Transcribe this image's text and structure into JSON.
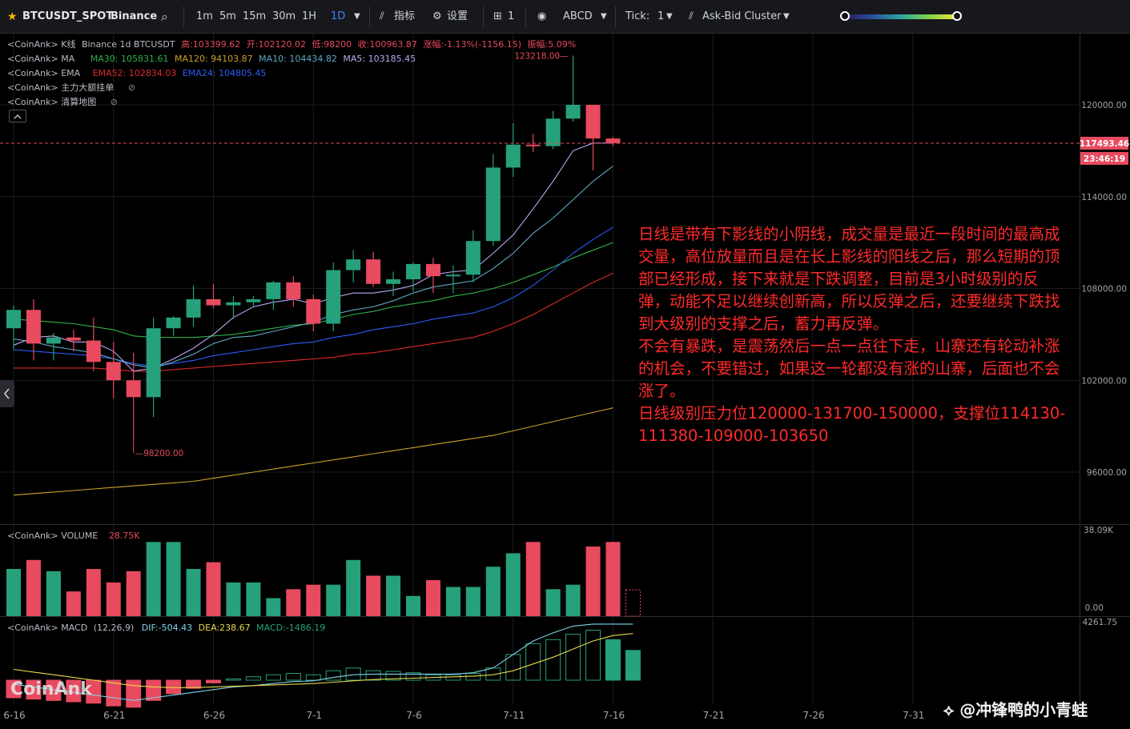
{
  "toolbar": {
    "symbol": "BTCUSDT_SPOT",
    "exchange": "Binance",
    "intervals": [
      "1m",
      "5m",
      "15m",
      "30m",
      "1H",
      "1D"
    ],
    "active_interval": "1D",
    "indicators_label": "指标",
    "settings_label": "设置",
    "layout_count": "1",
    "drawing_label": "ABCD",
    "tick_label": "Tick:",
    "tick_value": "1",
    "cluster_label": "Ask-Bid Cluster"
  },
  "legend": {
    "kline": {
      "prefix": "<CoinAnk> K线",
      "text": "Binance 1d BTCUSDT",
      "high": "高:103399.62",
      "open": "开:102120.02",
      "low": "低:98200",
      "close": "收:100963.87",
      "change": "涨幅:-1.13%(-1156.15)",
      "amplitude": "振幅:5.09%"
    },
    "ma": {
      "prefix": "<CoinAnk> MA",
      "ma30": "MA30: 105831.61",
      "ma120": "MA120: 94103.87",
      "ma10": "MA10: 104434.82",
      "ma5": "MA5: 103185.45"
    },
    "ema": {
      "prefix": "<CoinAnk> EMA",
      "ema52": "EMA52: 102834.03",
      "ema24": "EMA24: 104805.45"
    },
    "big_orders": "<CoinAnk> 主力大额挂单",
    "liquidation": "<CoinAnk> 清算地图",
    "volume": {
      "prefix": "<CoinAnk> VOLUME",
      "value": "28.75K"
    },
    "macd": {
      "prefix": "<CoinAnk> MACD",
      "params": "(12,26,9)",
      "dif": "DIF:-504.43",
      "dea": "DEA:238.67",
      "macd": "MACD:-1486.19"
    }
  },
  "colors": {
    "up": "#26a17b",
    "down": "#e84a5f",
    "ma5": "#b9a7f0",
    "ma10": "#5fa8c4",
    "ma30": "#2fb24a",
    "ma120": "#c9a227",
    "ema24": "#2c5cf5",
    "ema52": "#e02a2a",
    "dif": "#7fd4e8",
    "dea": "#e8d94a"
  },
  "annotation": [
    "日线是带有下影线的小阴线，成交量是最近一段时间的最高成交量，高位放量而且是在长上影线的阳线之后，那么短期的顶部已经形成，接下来就是下跌调整，目前是3小时级别的反弹，动能不足以继续创新高，所以反弹之后，还要继续下跌找到大级别的支撑之后，蓄力再反弹。",
    "不会有暴跌，是震荡然后一点一点往下走，山寨还有轮动补涨的机会，不要错过，如果这一轮都没有涨的山寨，后面也不会涨了。",
    "日线级别压力位120000-131700-150000，支撑位114130-111380-109000-103650"
  ],
  "watermark": "@冲锋鸭的小青蛙",
  "brand_logo": "CoinAnk",
  "chart_data": {
    "type": "candlestick",
    "price_axis": {
      "ticks": [
        120000,
        114000,
        108000,
        102000,
        96000
      ],
      "ylim": [
        94500,
        125000
      ]
    },
    "current_price": "117493.46",
    "countdown": "23:46:19",
    "high_marker": "123218.00",
    "low_marker": "98200.00",
    "volume_axis": {
      "ticks": [
        "38.09K",
        "0.00"
      ],
      "ylim": [
        0,
        38.09
      ]
    },
    "macd_axis": {
      "ticks": [
        "4261.75"
      ]
    },
    "x_ticks": [
      "6-16",
      "6-21",
      "6-26",
      "7-1",
      "7-6",
      "7-11",
      "7-16",
      "7-21",
      "7-26",
      "7-31"
    ],
    "x_start_day": 0,
    "candles": [
      {
        "o": 105400,
        "h": 106900,
        "l": 104000,
        "c": 106600
      },
      {
        "o": 106600,
        "h": 107300,
        "l": 103300,
        "c": 104400
      },
      {
        "o": 104400,
        "h": 105100,
        "l": 103300,
        "c": 104800
      },
      {
        "o": 104800,
        "h": 105300,
        "l": 103900,
        "c": 104600
      },
      {
        "o": 104600,
        "h": 106100,
        "l": 102600,
        "c": 103200
      },
      {
        "o": 103200,
        "h": 104500,
        "l": 100800,
        "c": 102000
      },
      {
        "o": 102000,
        "h": 103800,
        "l": 98200,
        "c": 100900
      },
      {
        "o": 100900,
        "h": 106100,
        "l": 99600,
        "c": 105400
      },
      {
        "o": 105400,
        "h": 106200,
        "l": 104900,
        "c": 106100
      },
      {
        "o": 106100,
        "h": 108200,
        "l": 105500,
        "c": 107300
      },
      {
        "o": 107300,
        "h": 108300,
        "l": 106700,
        "c": 106900
      },
      {
        "o": 106900,
        "h": 107500,
        "l": 106000,
        "c": 107100
      },
      {
        "o": 107100,
        "h": 107500,
        "l": 106800,
        "c": 107300
      },
      {
        "o": 107300,
        "h": 108500,
        "l": 106600,
        "c": 108400
      },
      {
        "o": 108400,
        "h": 108800,
        "l": 106800,
        "c": 107300
      },
      {
        "o": 107300,
        "h": 107600,
        "l": 105200,
        "c": 105700
      },
      {
        "o": 105700,
        "h": 109700,
        "l": 105200,
        "c": 109200
      },
      {
        "o": 109200,
        "h": 110500,
        "l": 108400,
        "c": 109900
      },
      {
        "o": 109900,
        "h": 110400,
        "l": 108100,
        "c": 108300
      },
      {
        "o": 108300,
        "h": 109100,
        "l": 107500,
        "c": 108600
      },
      {
        "o": 108600,
        "h": 109700,
        "l": 107800,
        "c": 109600
      },
      {
        "o": 109600,
        "h": 110000,
        "l": 107700,
        "c": 108800
      },
      {
        "o": 108800,
        "h": 109500,
        "l": 107700,
        "c": 108900
      },
      {
        "o": 108900,
        "h": 111800,
        "l": 108400,
        "c": 111100
      },
      {
        "o": 111100,
        "h": 116800,
        "l": 110800,
        "c": 115900
      },
      {
        "o": 115900,
        "h": 118800,
        "l": 115300,
        "c": 117400
      },
      {
        "o": 117400,
        "h": 118100,
        "l": 116900,
        "c": 117300
      },
      {
        "o": 117300,
        "h": 119600,
        "l": 117100,
        "c": 119100
      },
      {
        "o": 119100,
        "h": 123218,
        "l": 118900,
        "c": 120000
      },
      {
        "o": 120000,
        "h": 120000,
        "l": 115700,
        "c": 117800
      },
      {
        "o": 117800,
        "h": 117900,
        "l": 117300,
        "c": 117493
      }
    ],
    "volume": [
      21,
      25,
      20,
      11,
      21,
      15,
      20,
      33,
      33,
      21,
      24,
      15,
      15,
      8,
      12,
      14,
      14,
      25,
      18,
      18,
      9,
      16,
      13,
      13,
      22,
      28,
      33,
      12,
      14,
      31,
      33,
      0
    ],
    "macd_hist": [
      -1300,
      -1400,
      -1500,
      -1600,
      -1700,
      -1900,
      -2000,
      -1500,
      -1000,
      -600,
      -200,
      100,
      250,
      400,
      500,
      400,
      700,
      900,
      700,
      650,
      550,
      400,
      400,
      500,
      900,
      1900,
      2700,
      3000,
      3400,
      3700,
      3000,
      2200
    ],
    "dif": [
      -300,
      -500,
      -700,
      -900,
      -1100,
      -1300,
      -1500,
      -1300,
      -1100,
      -900,
      -700,
      -500,
      -400,
      -250,
      -100,
      -50,
      200,
      400,
      450,
      450,
      450,
      450,
      450,
      550,
      900,
      1900,
      2900,
      3500,
      4000,
      4150,
      4150,
      4150
    ],
    "dea": [
      800,
      600,
      400,
      200,
      0,
      -200,
      -400,
      -500,
      -550,
      -550,
      -500,
      -450,
      -400,
      -350,
      -300,
      -250,
      -150,
      -50,
      50,
      100,
      150,
      200,
      250,
      300,
      400,
      700,
      1200,
      1700,
      2300,
      2900,
      3300,
      3450
    ],
    "ma5": [
      104300,
      104800,
      104900,
      104500,
      104500,
      103900,
      102600,
      102800,
      103400,
      104100,
      105000,
      106100,
      106800,
      107100,
      107300,
      107000,
      107400,
      107700,
      107700,
      107900,
      108200,
      108900,
      109100,
      109200,
      110300,
      111500,
      113200,
      115000,
      117000,
      117500,
      117500
    ],
    "ma10": [
      104700,
      104500,
      104200,
      104000,
      103800,
      103400,
      103000,
      102800,
      103200,
      103700,
      104400,
      104800,
      104900,
      105200,
      105500,
      105800,
      106300,
      106600,
      106800,
      107200,
      107700,
      108100,
      108300,
      108500,
      109300,
      110300,
      111600,
      112600,
      113800,
      115000,
      116000
    ],
    "ema24": [
      104000,
      103900,
      103800,
      103700,
      103600,
      103400,
      103100,
      102900,
      103100,
      103300,
      103600,
      103800,
      104000,
      104200,
      104400,
      104500,
      104800,
      105000,
      105300,
      105500,
      105700,
      106000,
      106200,
      106400,
      106800,
      107400,
      108200,
      109200,
      110300,
      111200,
      112000
    ],
    "ma30": [
      106000,
      105900,
      105800,
      105700,
      105500,
      105300,
      104900,
      104800,
      104800,
      104800,
      104900,
      105000,
      105200,
      105400,
      105600,
      105700,
      106000,
      106300,
      106500,
      106800,
      107000,
      107200,
      107500,
      107700,
      108000,
      108400,
      108900,
      109400,
      110000,
      110500,
      111000
    ],
    "ema52": [
      102800,
      102800,
      102800,
      102800,
      102800,
      102700,
      102600,
      102600,
      102700,
      102800,
      102900,
      103000,
      103100,
      103200,
      103300,
      103400,
      103500,
      103700,
      103800,
      104000,
      104200,
      104400,
      104600,
      104800,
      105200,
      105700,
      106300,
      107000,
      107700,
      108400,
      109000
    ],
    "ma120": [
      94500,
      94600,
      94700,
      94800,
      94900,
      95000,
      95100,
      95200,
      95300,
      95400,
      95600,
      95800,
      96000,
      96200,
      96400,
      96600,
      96800,
      97000,
      97200,
      97400,
      97600,
      97800,
      98000,
      98200,
      98400,
      98700,
      99000,
      99300,
      99600,
      99900,
      100200
    ]
  }
}
